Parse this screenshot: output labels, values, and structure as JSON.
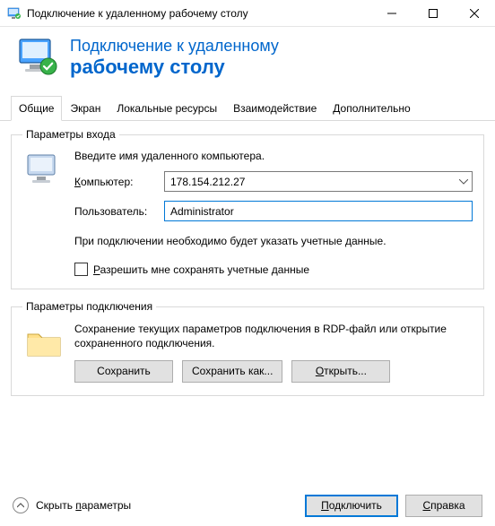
{
  "window": {
    "title": "Подключение к удаленному рабочему столу"
  },
  "banner": {
    "line1": "Подключение к удаленному",
    "line2": "рабочему столу"
  },
  "tabs": {
    "general": "Общие",
    "display": "Экран",
    "local": "Локальные ресурсы",
    "experience": "Взаимодействие",
    "advanced": "Дополнительно"
  },
  "login": {
    "legend": "Параметры входа",
    "prompt": "Введите имя удаленного компьютера.",
    "computer_label": "Компьютер:",
    "computer_underline": "К",
    "computer_value": "178.154.212.27",
    "user_label": "Пользователь:",
    "user_value": "Administrator",
    "hint": "При подключении необходимо будет указать учетные данные.",
    "remember": "Разрешить мне сохранять учетные данные",
    "remember_underline": "Р"
  },
  "connection": {
    "legend": "Параметры подключения",
    "desc": "Сохранение текущих параметров подключения в RDP-файл или открытие сохраненного подключения.",
    "save": "Сохранить",
    "save_as": "Сохранить как...",
    "open": "Открыть...",
    "open_underline": "О"
  },
  "footer": {
    "collapse": "Скрыть параметры",
    "collapse_underline": "п",
    "connect": "Подключить",
    "connect_underline": "П",
    "help": "Справка",
    "help_underline": "С"
  }
}
